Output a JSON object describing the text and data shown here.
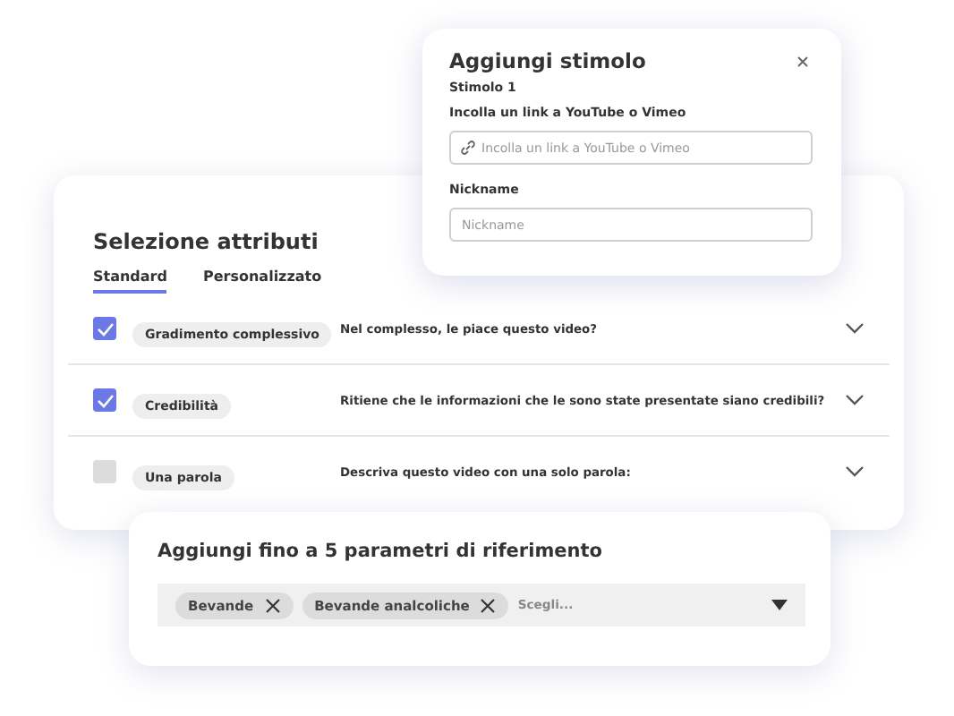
{
  "attributes_card": {
    "title": "Selezione attributi",
    "tabs": [
      {
        "label": "Standard",
        "selected": true
      },
      {
        "label": "Personalizzato",
        "selected": false
      }
    ],
    "rows": [
      {
        "checked": true,
        "attribute": "Gradimento complessivo",
        "question": "Nel complesso, le piace questo video?"
      },
      {
        "checked": true,
        "attribute": "Credibilità",
        "question": "Ritiene che le informazioni che le sono state presentate siano credibili?"
      },
      {
        "checked": false,
        "attribute": "Una parola",
        "question": "Descriva questo video con una solo parola:"
      }
    ]
  },
  "stimulus_dialog": {
    "title": "Aggiungi stimolo",
    "subtitle": "Stimolo 1",
    "link_label": "Incolla un link a YouTube o Vimeo",
    "link_placeholder": "Incolla un link a YouTube o Vimeo",
    "nickname_label": "Nickname",
    "nickname_placeholder": "Nickname"
  },
  "parameters_card": {
    "title": "Aggiungi fino a 5 parametri di riferimento",
    "tags": [
      "Bevande",
      "Bevande analcoliche"
    ],
    "placeholder": "Scegli..."
  }
}
